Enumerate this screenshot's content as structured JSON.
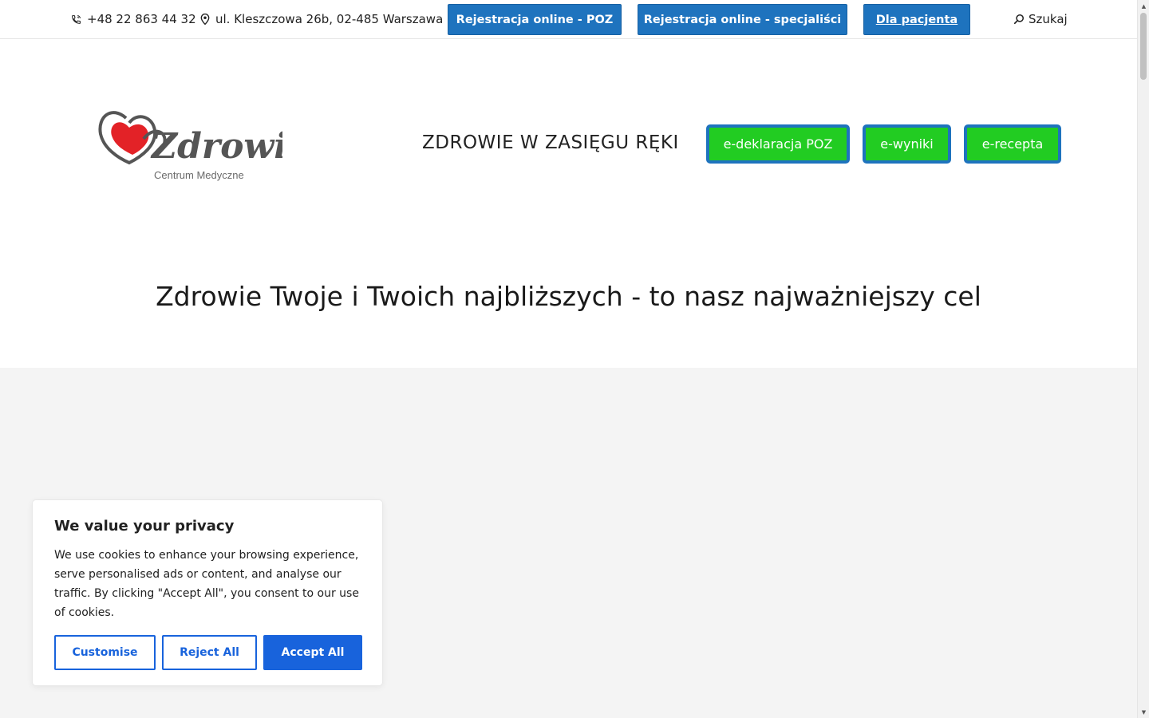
{
  "topbar": {
    "phone": "+48 22 863 44 32",
    "address": "ul. Kleszczowa 26b, 02-485 Warszawa",
    "btn_poz": "Rejestracja online - POZ",
    "btn_spec": "Rejestracja online - specjaliści",
    "btn_pacjent": "Dla pacjenta",
    "search": "Szukaj"
  },
  "logo": {
    "word": "Zdrowie",
    "subtitle": "Centrum Medyczne",
    "heart_color": "#e32227",
    "outline_color": "#555555"
  },
  "header": {
    "tagline": "ZDROWIE W ZASIĘGU RĘKI",
    "buttons": [
      "e-deklaracja POZ",
      "e-wyniki",
      "e-recepta"
    ]
  },
  "hero": {
    "title": "Zdrowie Twoje i Twoich najbliższych - to nasz najważniejszy cel"
  },
  "cookie": {
    "title": "We value your privacy",
    "text": "We use cookies to enhance your browsing experience, serve personalised ads or content, and analyse our traffic. By clicking \"Accept All\", you consent to our use of cookies.",
    "customise": "Customise",
    "reject": "Reject All",
    "accept": "Accept All"
  },
  "colors": {
    "primary_blue": "#1e73be",
    "green": "#22cc22",
    "cookie_blue": "#1863dc"
  }
}
